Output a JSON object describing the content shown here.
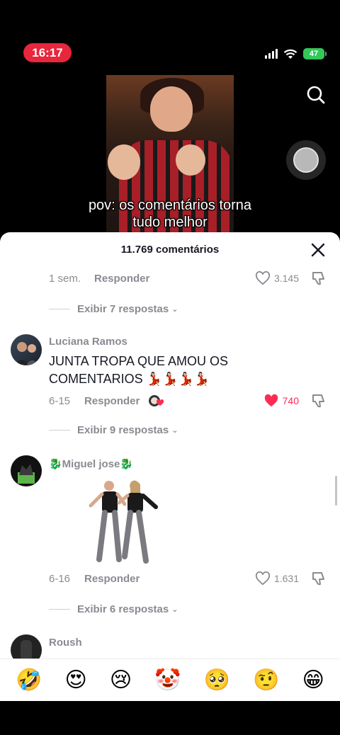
{
  "status": {
    "time": "16:17",
    "battery": "47"
  },
  "video": {
    "caption_line1": "pov: os comentários torna",
    "caption_line2": "tudo melhor"
  },
  "sheet": {
    "title": "11.769 comentários"
  },
  "top_comment": {
    "date": "1 sem.",
    "reply_label": "Responder",
    "likes": "3.145",
    "view_replies": "Exibir 7 respostas"
  },
  "comments": [
    {
      "username": "Luciana Ramos",
      "text": "JUNTA TROPA QUE AMOU OS COMENTARIOS 💃🏻💃🏻💃🏻💃🏻",
      "date": "6-15",
      "reply_label": "Responder",
      "likes": "740",
      "liked": true,
      "view_replies": "Exibir 9 respostas"
    },
    {
      "username": "🐉Miguel jose🐉",
      "text": "",
      "date": "6-16",
      "reply_label": "Responder",
      "likes": "1.631",
      "liked": false,
      "view_replies": "Exibir 6 respostas"
    },
    {
      "username": "Roush"
    }
  ],
  "emoji_bar": [
    "🤣",
    "😍",
    "😢",
    "🤡",
    "🥺",
    "🤨",
    "😁"
  ],
  "colors": {
    "accent": "#fe2c55",
    "status_pill": "#e8263c",
    "battery": "#34c759"
  },
  "icons": [
    "search-icon",
    "record-icon",
    "close-icon",
    "heart-icon",
    "dislike-icon",
    "chevron-down-icon"
  ]
}
